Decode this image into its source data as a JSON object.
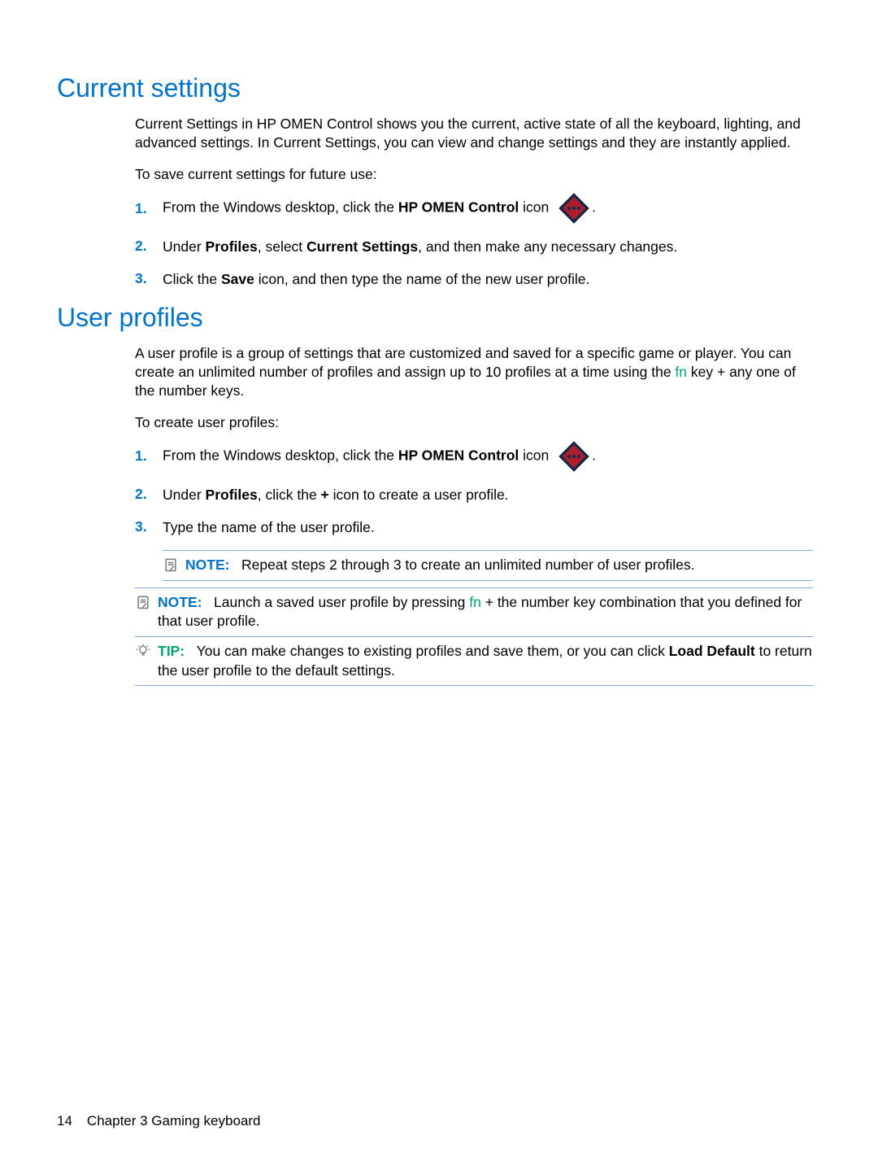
{
  "sections": {
    "current": {
      "heading": "Current settings",
      "intro_parts": [
        "Current Settings in HP OMEN Control shows you the current, active state of all the keyboard, lighting, and advanced settings. In Current Settings, you can view and change settings and they are instantly applied."
      ],
      "lead": "To save current settings for future use:",
      "steps": {
        "s1_pre": "From the Windows desktop, click the ",
        "s1_bold": "HP OMEN Control",
        "s1_post": " icon ",
        "s1_tail": ".",
        "s2_a": "Under ",
        "s2_b": "Profiles",
        "s2_c": ", select ",
        "s2_d": "Current Settings",
        "s2_e": ", and then make any necessary changes.",
        "s3_a": "Click the ",
        "s3_b": "Save",
        "s3_c": " icon, and then type the name of the new user profile."
      }
    },
    "profiles": {
      "heading": "User profiles",
      "intro_a": "A user profile is a group of settings that are customized and saved for a specific game or player. You can create an unlimited number of profiles and assign up to 10 profiles at a time using the ",
      "intro_fn": "fn",
      "intro_b": " key + any one of the number keys.",
      "lead": "To create user profiles:",
      "steps": {
        "s1_pre": "From the Windows desktop, click the ",
        "s1_bold": "HP OMEN Control",
        "s1_post": " icon ",
        "s1_tail": ".",
        "s2_a": "Under ",
        "s2_b": "Profiles",
        "s2_c": ", click the ",
        "s2_d": "+",
        "s2_e": " icon to create a user profile.",
        "s3": "Type the name of the user profile."
      },
      "note_inside": {
        "label": "NOTE:",
        "text": "Repeat steps 2 through 3 to create an unlimited number of user profiles."
      },
      "note_outside": {
        "label": "NOTE:",
        "pre": "Launch a saved user profile by pressing ",
        "fn": "fn",
        "post": " + the number key combination that you defined for that user profile."
      },
      "tip": {
        "label": "TIP:",
        "pre": "You can make changes to existing profiles and save them, or you can click ",
        "bold": "Load Default",
        "post": " to return the user profile to the default settings."
      }
    }
  },
  "nums": {
    "n1": "1.",
    "n2": "2.",
    "n3": "3."
  },
  "footer": {
    "page": "14",
    "chapter": "Chapter 3   Gaming keyboard"
  }
}
